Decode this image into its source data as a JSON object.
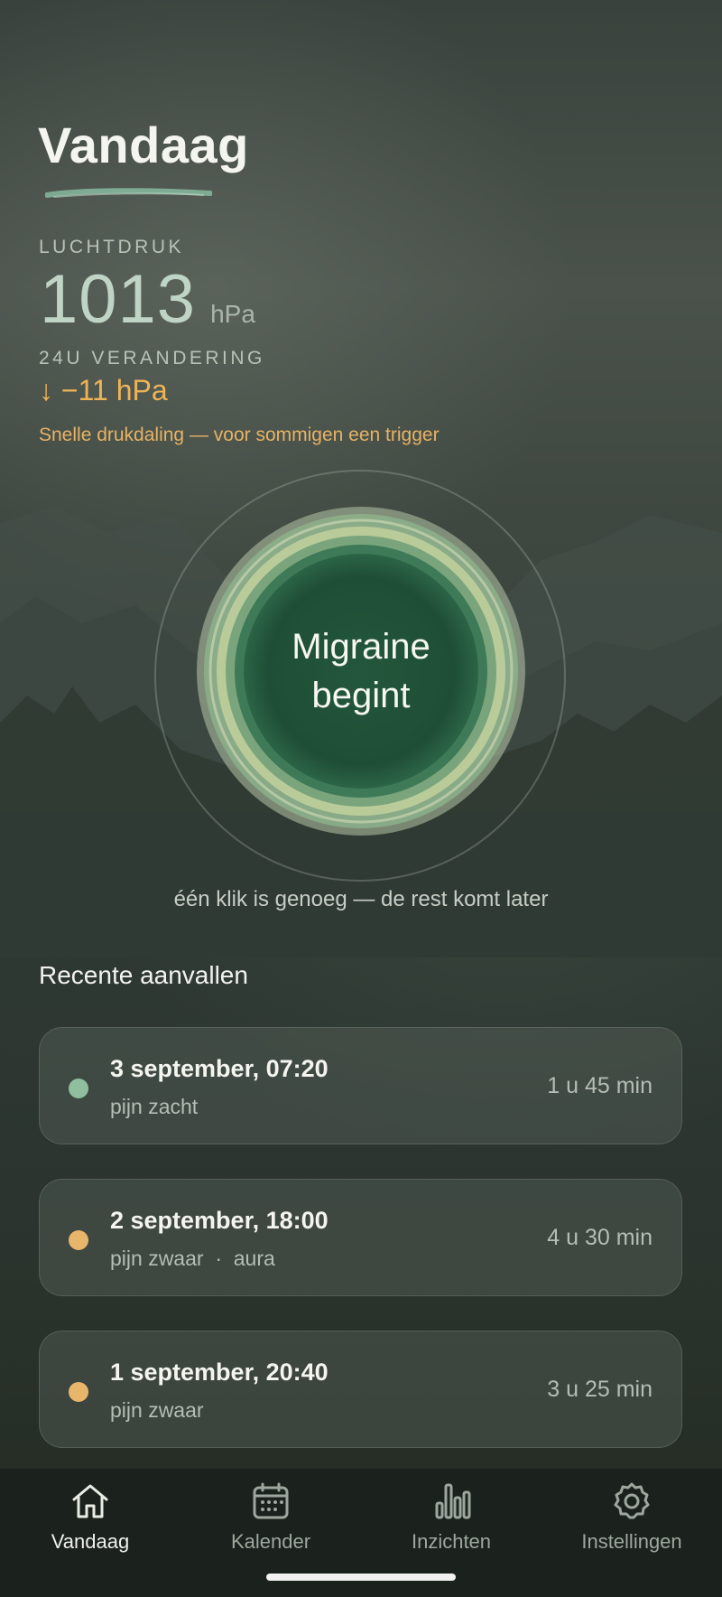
{
  "page": {
    "title": "Vandaag"
  },
  "pressure": {
    "label": "LUCHTDRUK",
    "value": "1013",
    "unit": "hPa",
    "change_label": "24U VERANDERING",
    "change_value": "↓ −11 hPa",
    "warning": "Snelle drukdaling — voor sommigen een trigger"
  },
  "log_button": {
    "line1": "Migraine",
    "line2": "begint",
    "hint": "één klik is genoeg — de rest komt later"
  },
  "recent": {
    "heading": "Recente aanvallen",
    "items": [
      {
        "title": "3 september, 07:20",
        "sub": "pijn zacht",
        "duration": "1 u 45 min",
        "color": "#8fbf9f"
      },
      {
        "title": "2 september, 18:00",
        "sub": "pijn zwaar  ·  aura",
        "duration": "4 u 30 min",
        "color": "#e8b66a"
      },
      {
        "title": "1 september, 20:40",
        "sub": "pijn zwaar",
        "duration": "3 u 25 min",
        "color": "#e8b66a"
      }
    ]
  },
  "tabs": [
    {
      "label": "Vandaag",
      "icon": "home-icon",
      "active": true
    },
    {
      "label": "Kalender",
      "icon": "calendar-icon"
    },
    {
      "label": "Inzichten",
      "icon": "bar-chart-icon"
    },
    {
      "label": "Instellingen",
      "icon": "gear-icon"
    }
  ],
  "colors": {
    "accent_green": "#2f6b4a",
    "warning_orange": "#efb457",
    "pressure_value": "#bfd4c4"
  }
}
